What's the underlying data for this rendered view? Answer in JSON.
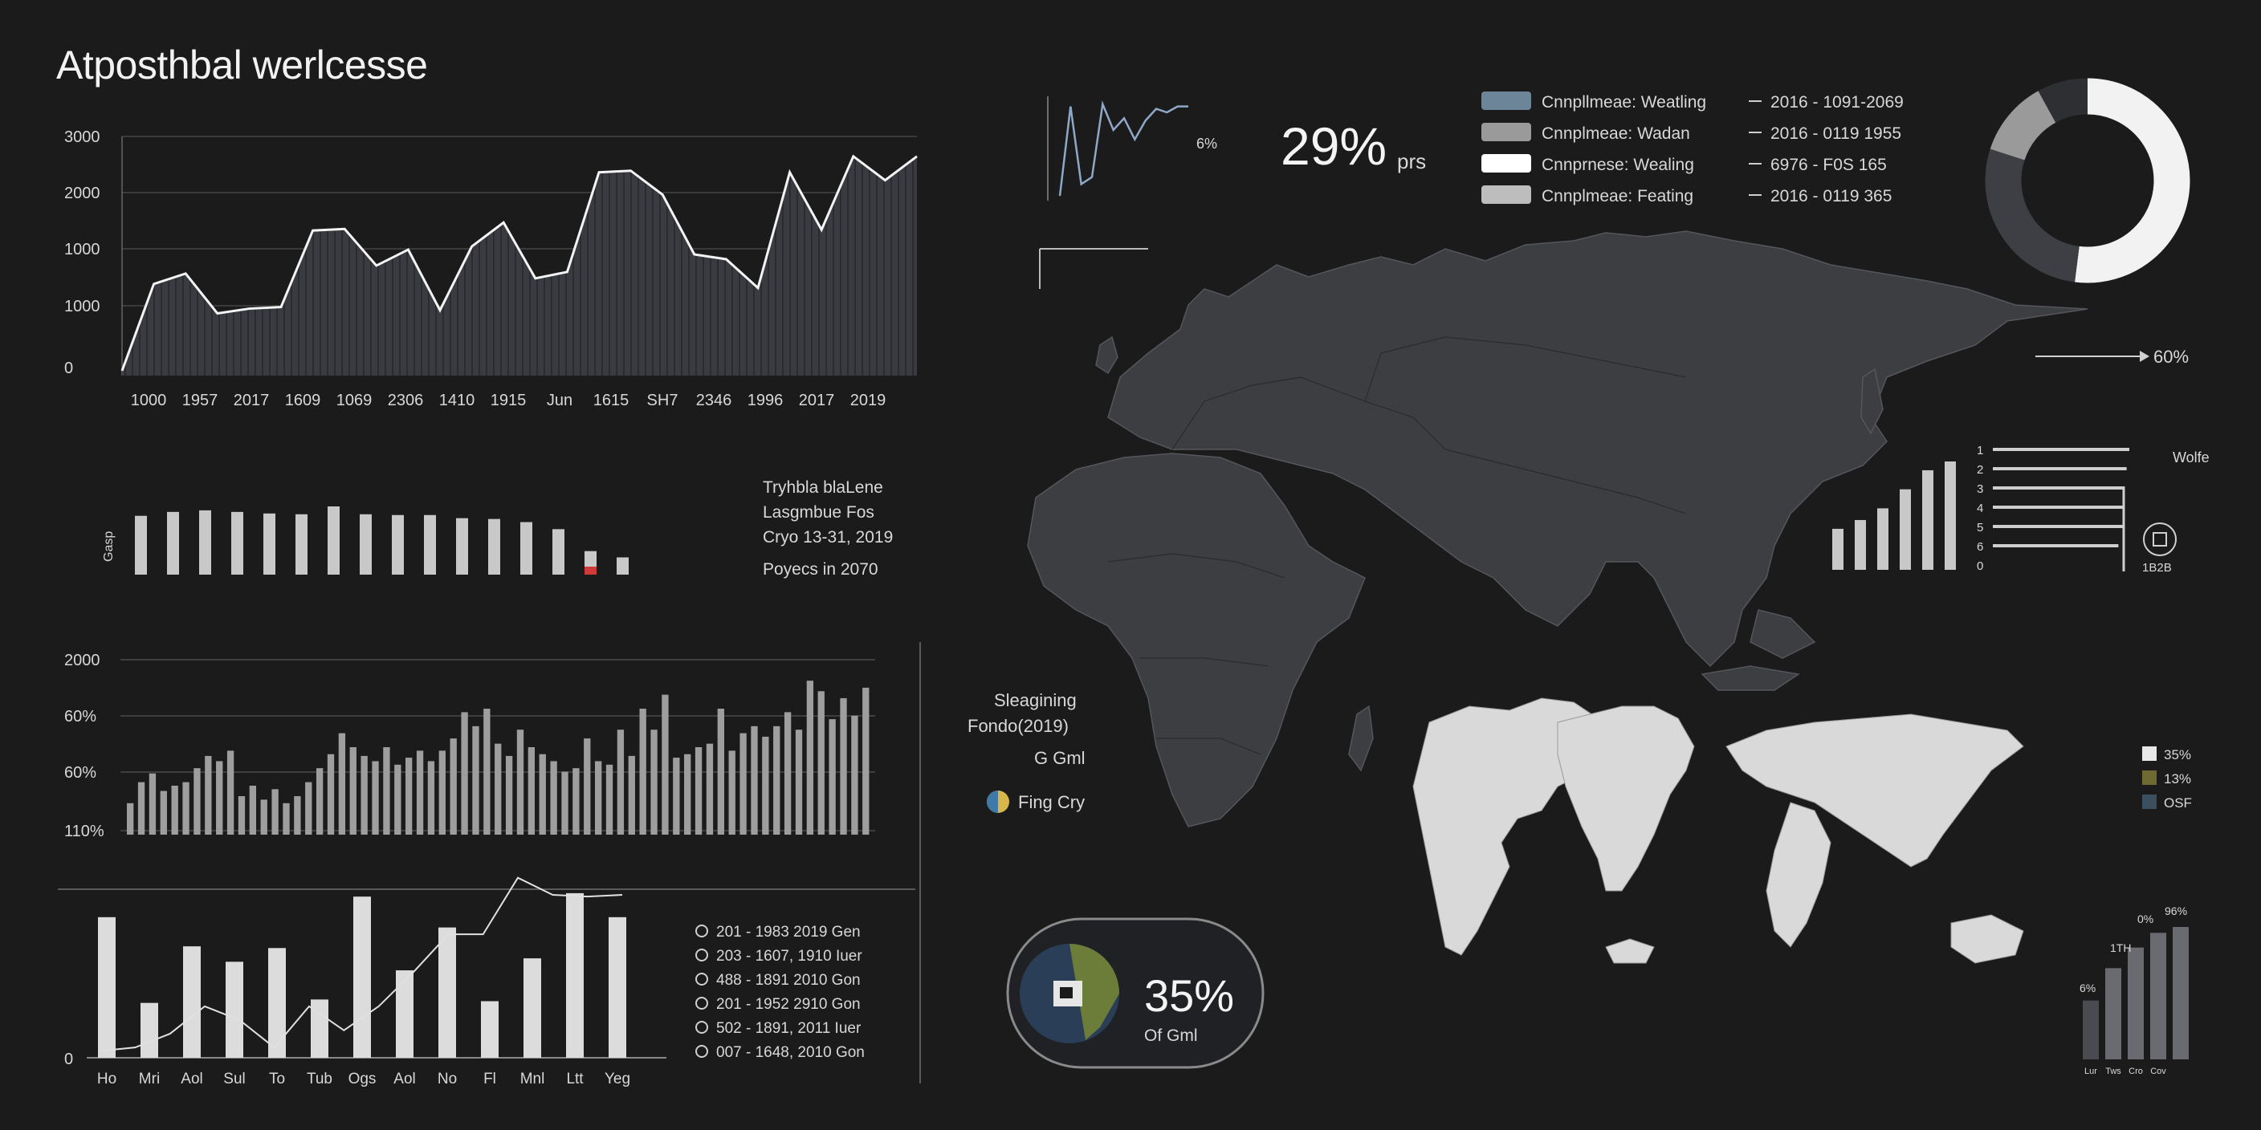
{
  "title": "Atposthbal werlcesse",
  "stat_29": {
    "value": "29%",
    "unit": "prs"
  },
  "stat_35": {
    "value": "35%",
    "label": "Of Gml"
  },
  "spark_label": "6%",
  "arrow_label": "60%",
  "mid_text": [
    "Tryhbla blaLene",
    "Lasgmbue Fos",
    "Cryo 13-31, 2019",
    "Poyecs in 2070"
  ],
  "center_text": [
    "Sleagining",
    "Fondo(2019)",
    "G Gml"
  ],
  "center_legend": "Fing Cry",
  "colors": {
    "bg": "#1b1b1c",
    "area": "#3a3b41",
    "bar": "#c8c8c8",
    "accent_red": "#d03a3a",
    "map": "#3d3e42",
    "map_light": "#d9d9d9",
    "blue": "#8fa8c8"
  },
  "chart_data": [
    {
      "type": "area",
      "y_ticks": [
        "3000",
        "2000",
        "1000",
        "1000",
        "0"
      ],
      "x_labels": [
        "1000",
        "1957",
        "2017",
        "1609",
        "1069",
        "2306",
        "1410",
        "1915",
        "Jun",
        "1615",
        "SH7",
        "2346",
        "1996",
        "2017",
        "2019"
      ],
      "ylim": [
        0,
        3000
      ],
      "line": [
        60,
        1150,
        1280,
        780,
        840,
        860,
        1820,
        1840,
        1380,
        1580,
        820,
        1620,
        1920,
        1220,
        1300,
        2550,
        2570,
        2270,
        1520,
        1460,
        1100,
        2550,
        1830,
        2750,
        2450,
        2750
      ]
    },
    {
      "type": "bar",
      "ylabel": "Gasp",
      "values": [
        75,
        80,
        82,
        80,
        78,
        77,
        87,
        77,
        76,
        76,
        72,
        71,
        67,
        58,
        30,
        22
      ],
      "highlight_index": 14
    },
    {
      "type": "bar",
      "y_ticks": [
        "2000",
        "60%",
        "60%",
        "110%"
      ],
      "values": [
        18,
        30,
        35,
        25,
        28,
        30,
        38,
        45,
        42,
        48,
        22,
        28,
        20,
        26,
        18,
        22,
        30,
        38,
        46,
        58,
        50,
        45,
        42,
        50,
        40,
        44,
        48,
        42,
        48,
        55,
        70,
        62,
        72,
        52,
        45,
        60,
        50,
        46,
        42,
        36,
        38,
        55,
        42,
        40,
        60,
        45,
        72,
        60,
        80,
        44,
        46,
        50,
        52,
        72,
        48,
        58,
        62,
        56,
        62,
        70,
        60,
        88,
        82,
        66,
        78,
        68,
        84
      ],
      "ylim": [
        0,
        100
      ]
    },
    {
      "type": "bar",
      "y_ticks": [
        "0"
      ],
      "x_labels": [
        "Ho",
        "Mri",
        "Aol",
        "Sul",
        "To",
        "Tub",
        "Ogs",
        "Aol",
        "No",
        "Fl",
        "Mnl",
        "Ltt",
        "Yeg"
      ],
      "values": [
        82,
        32,
        65,
        56,
        64,
        34,
        94,
        51,
        76,
        33,
        58,
        96,
        82
      ],
      "line": [
        4,
        6,
        14,
        30,
        22,
        6,
        30,
        16,
        30,
        50,
        72,
        72,
        105,
        95,
        94,
        95
      ],
      "ylim": [
        0,
        110
      ],
      "legend": [
        "201 - 1983 2019 Gen",
        "203 - 1607, 1910 Iuer",
        "488 - 1891 2010 Gon",
        "201 - 1952 2910 Gon",
        "502 - 1891, 2011 Iuer",
        "007 - 1648, 2010 Gon"
      ]
    },
    {
      "type": "line",
      "values": [
        4,
        80,
        14,
        20,
        82,
        60,
        70,
        52,
        68,
        78,
        75,
        80,
        80
      ]
    },
    {
      "type": "table",
      "legend": [
        {
          "name": "Cnnpllmeae: Weatling",
          "range": "2016 - 1091-2069",
          "color": "#6d8598"
        },
        {
          "name": "Cnnplmeae: Wadan",
          "range": "2016 - 0119 1955",
          "color": "#9a9a9a"
        },
        {
          "name": "Cnnprnese: Wealing",
          "range": "6976 - F0S 165",
          "color": "#ffffff"
        },
        {
          "name": "Cnnplmeae: Feating",
          "range": "2016 - 0119 365",
          "color": "#bdbdbd"
        }
      ]
    },
    {
      "type": "pie",
      "values": [
        52,
        28,
        12,
        8
      ],
      "colors": [
        "#f2f2f2",
        "#3e3f44",
        "#9a9a9a",
        "#2e2f33"
      ]
    },
    {
      "type": "bar",
      "values": [
        28,
        34,
        42,
        55,
        68,
        74
      ],
      "hbar_ticks": [
        "1",
        "2",
        "3",
        "4",
        "5",
        "6",
        "0"
      ],
      "hbar_values": [
        100,
        98,
        96,
        95,
        96,
        92
      ],
      "side_labels": [
        "Wolfe",
        "1B2B"
      ]
    },
    {
      "type": "bar",
      "values": [
        40,
        62,
        76,
        86,
        90
      ],
      "labels": [
        "6%",
        "1TH",
        "0%",
        "96%"
      ],
      "x_labels": [
        "Lur",
        "Tws",
        "Cro",
        "Cov"
      ]
    },
    {
      "type": "table",
      "legend": [
        {
          "name": "35%",
          "color": "#e8e8e8"
        },
        {
          "name": "13%",
          "color": "#6f6a32"
        },
        {
          "name": "OSF",
          "color": "#3b4f5f"
        }
      ]
    }
  ]
}
